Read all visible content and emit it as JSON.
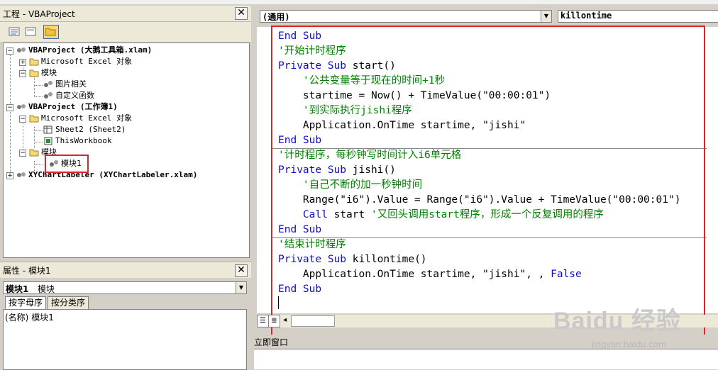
{
  "project_panel": {
    "title": "工程 - VBAProject",
    "tree": [
      {
        "label": "VBAProject (大鹅工具箱.xlam)",
        "type": "project"
      },
      {
        "label": "Microsoft Excel 对象",
        "type": "folder"
      },
      {
        "label": "模块",
        "type": "folder"
      },
      {
        "label": "图片相关",
        "type": "module"
      },
      {
        "label": "自定义函数",
        "type": "module"
      },
      {
        "label": "VBAProject (工作簿1)",
        "type": "project"
      },
      {
        "label": "Microsoft Excel 对象",
        "type": "folder"
      },
      {
        "label": "Sheet2 (Sheet2)",
        "type": "sheet"
      },
      {
        "label": "ThisWorkbook",
        "type": "workbook"
      },
      {
        "label": "模块",
        "type": "folder"
      },
      {
        "label": "模块1",
        "type": "module"
      },
      {
        "label": "XYChartLabeler (XYChartLabeler.xlam)",
        "type": "project"
      }
    ]
  },
  "properties_panel": {
    "title": "属性 - 模块1",
    "object_name": "模块1",
    "object_type": "模块",
    "tabs": [
      "按字母序",
      "按分类序"
    ],
    "row_name": "(名称)",
    "row_value": "模块1"
  },
  "code_window": {
    "object_combo": "(通用)",
    "proc_combo": "killontime",
    "lines": [
      {
        "segs": [
          {
            "t": "End Sub",
            "c": "kw"
          }
        ]
      },
      {
        "segs": [
          {
            "t": "'开始计时程序",
            "c": "cm"
          }
        ]
      },
      {
        "segs": [
          {
            "t": "Private Sub ",
            "c": "kw"
          },
          {
            "t": "start()",
            "c": ""
          }
        ]
      },
      {
        "segs": [
          {
            "t": "    '公共变量等于现在的时间+1秒",
            "c": "cm"
          }
        ]
      },
      {
        "segs": [
          {
            "t": "    startime = Now() + TimeValue(\"00:00:01\")",
            "c": ""
          }
        ]
      },
      {
        "segs": [
          {
            "t": "    '到实际执行jishi程序",
            "c": "cm"
          }
        ]
      },
      {
        "segs": [
          {
            "t": "    Application.OnTime startime, \"jishi\"",
            "c": ""
          }
        ]
      },
      {
        "segs": [
          {
            "t": "End Sub",
            "c": "kw"
          }
        ]
      },
      {
        "segs": [
          {
            "t": "'计时程序，每秒钟写时间计入i6单元格",
            "c": "cm"
          }
        ]
      },
      {
        "segs": [
          {
            "t": "Private Sub ",
            "c": "kw"
          },
          {
            "t": "jishi()",
            "c": ""
          }
        ]
      },
      {
        "segs": [
          {
            "t": "    '自己不断的加一秒钟时间",
            "c": "cm"
          }
        ]
      },
      {
        "segs": [
          {
            "t": "    Range(\"i6\").Value = Range(\"i6\").Value + TimeValue(\"00:00:01\")",
            "c": ""
          }
        ]
      },
      {
        "segs": [
          {
            "t": "    Call ",
            "c": "kw"
          },
          {
            "t": "start ",
            "c": ""
          },
          {
            "t": "'又回头调用start程序，形成一个反复调用的程序",
            "c": "cm"
          }
        ]
      },
      {
        "segs": [
          {
            "t": "End Sub",
            "c": "kw"
          }
        ]
      },
      {
        "segs": [
          {
            "t": "'结束计时程序",
            "c": "cm"
          }
        ]
      },
      {
        "segs": [
          {
            "t": "Private Sub ",
            "c": "kw"
          },
          {
            "t": "killontime()",
            "c": ""
          }
        ]
      },
      {
        "segs": [
          {
            "t": "    Application.OnTime startime, \"jishi\", , ",
            "c": ""
          },
          {
            "t": "False",
            "c": "kw"
          }
        ]
      },
      {
        "segs": [
          {
            "t": "End Sub",
            "c": "kw"
          }
        ]
      }
    ]
  },
  "immediate_window": {
    "title": "立即窗口"
  },
  "watermark": {
    "brand": "Baidu 经验",
    "url": "jingyan.baidu.com"
  },
  "colors": {
    "keyword": "#0d0dcf",
    "comment": "#008000",
    "highlight_box": "#d9252b"
  }
}
